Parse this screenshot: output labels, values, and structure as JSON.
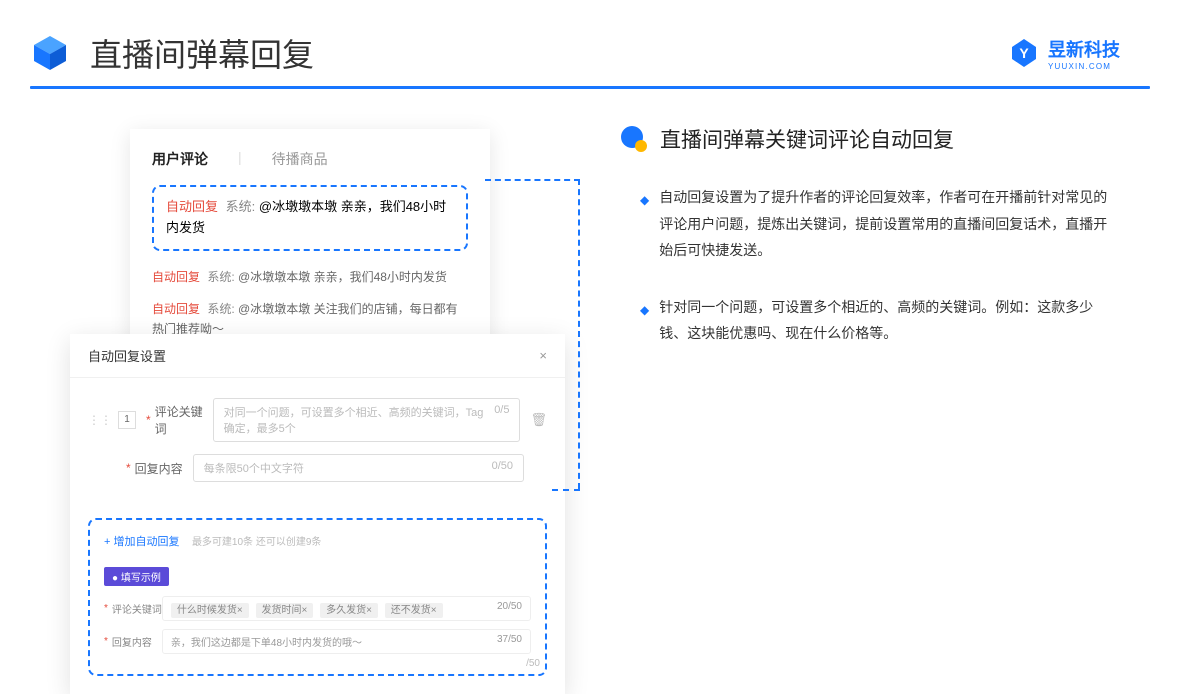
{
  "page_title": "直播间弹幕回复",
  "brand": {
    "cn": "昱新科技",
    "en": "YUUXIN.COM"
  },
  "comments_card": {
    "tab1": "用户评论",
    "tab2": "待播商品",
    "highlighted": {
      "tag": "自动回复",
      "sys": "系统:",
      "text": "@冰墩墩本墩 亲亲，我们48小时内发货"
    },
    "rows": [
      {
        "tag": "自动回复",
        "sys": "系统:",
        "text": "@冰墩墩本墩 亲亲，我们48小时内发货"
      },
      {
        "tag": "自动回复",
        "sys": "系统:",
        "text": "@冰墩墩本墩 关注我们的店铺，每日都有热门推荐呦～"
      }
    ]
  },
  "settings": {
    "title": "自动回复设置",
    "order": "1",
    "label_keyword": "评论关键词",
    "placeholder_keyword": "对同一个问题，可设置多个相近、高频的关键词，Tag确定，最多5个",
    "count_keyword": "0/5",
    "label_content": "回复内容",
    "placeholder_content": "每条限50个中文字符",
    "count_content": "0/50",
    "add_link": "+ 增加自动回复",
    "add_hint": "最多可建10条 还可以创建9条",
    "example_badge": "● 填写示例",
    "ex_label1": "评论关键词",
    "ex_tags": [
      "什么时候发货×",
      "发货时间×",
      "多久发货×",
      "还不发货×"
    ],
    "ex_count1": "20/50",
    "ex_label2": "回复内容",
    "ex_content": "亲，我们这边都是下单48小时内发货的哦～",
    "ex_count2": "37/50",
    "extra_counter": "/50"
  },
  "right": {
    "subtitle": "直播间弹幕关键词评论自动回复",
    "bullets": [
      "自动回复设置为了提升作者的评论回复效率，作者可在开播前针对常见的评论用户问题，提炼出关键词，提前设置常用的直播间回复话术，直播开始后可快捷发送。",
      "针对同一个问题，可设置多个相近的、高频的关键词。例如：这款多少钱、这块能优惠吗、现在什么价格等。"
    ]
  }
}
